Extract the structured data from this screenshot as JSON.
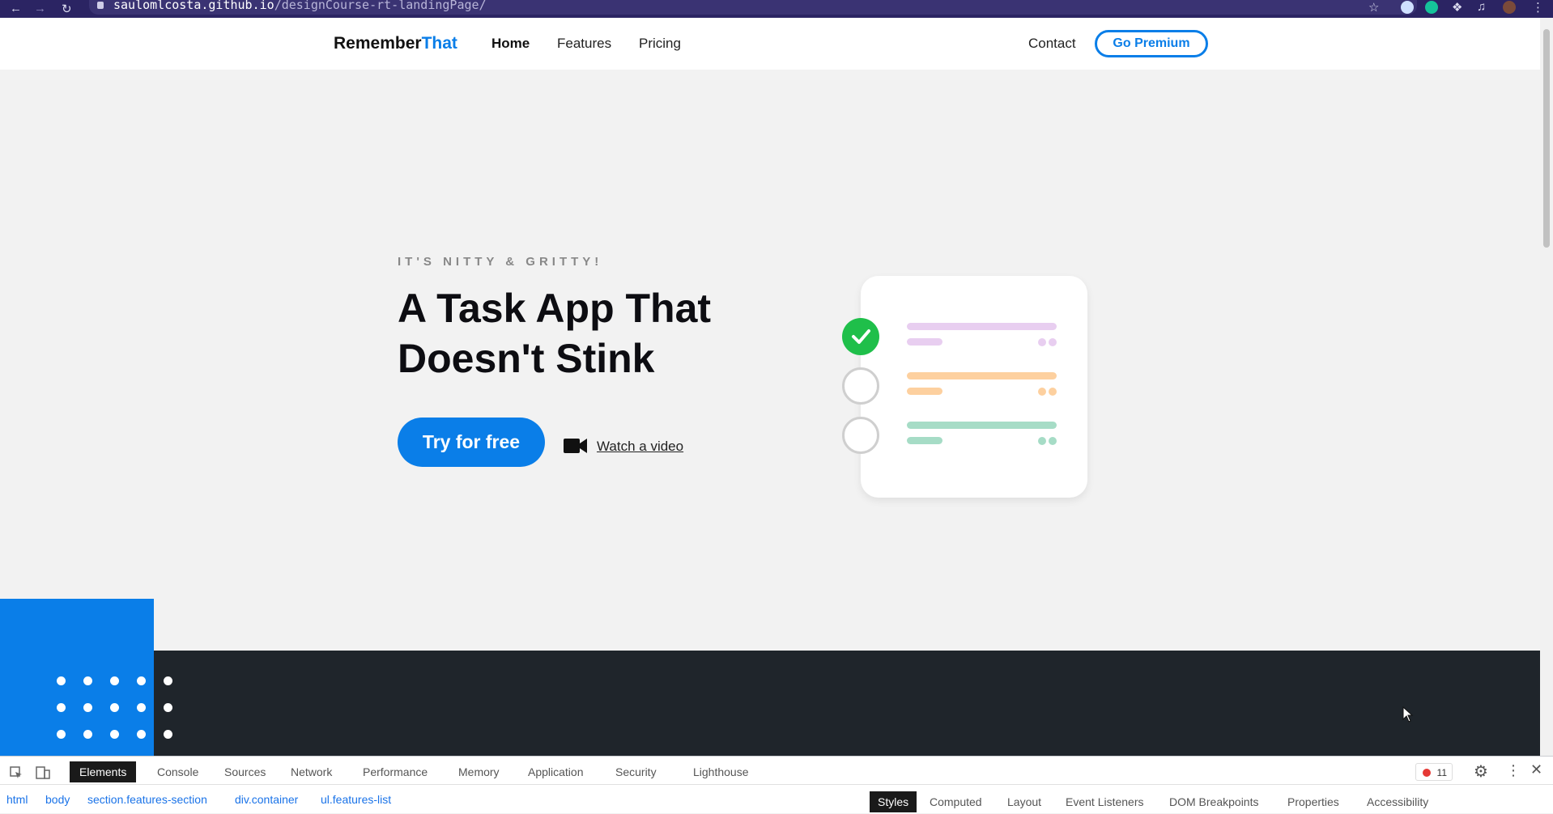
{
  "browser": {
    "url_host": "saulomlcosta.github.io",
    "url_path": "/designCourse-rt-landingPage/"
  },
  "header": {
    "logo_main": "Remember",
    "logo_accent": "That",
    "nav": [
      "Home",
      "Features",
      "Pricing"
    ],
    "contact": "Contact",
    "premium": "Go Premium"
  },
  "hero": {
    "eyebrow": "IT'S NITTY & GRITTY!",
    "title_line1": "A Task App That",
    "title_line2": "Doesn't Stink",
    "cta": "Try for free",
    "video_link": "Watch a video"
  },
  "illustration": {
    "rows": [
      {
        "checked": true,
        "color": "#e8cef0"
      },
      {
        "checked": false,
        "color": "#fdd09f"
      },
      {
        "checked": false,
        "color": "#a6dcc6"
      }
    ],
    "check_color": "#1fbf4a"
  },
  "colors": {
    "accent": "#0a7ee8",
    "dark_section": "#1f252b",
    "chrome": "#2b2463"
  },
  "devtools": {
    "tabs": [
      "Elements",
      "Console",
      "Sources",
      "Network",
      "Performance",
      "Memory",
      "Application",
      "Security",
      "Lighthouse"
    ],
    "error_count": "11",
    "breadcrumbs": [
      "html",
      "body",
      "section.features-section",
      "div.container",
      "ul.features-list"
    ],
    "side_tabs": [
      "Styles",
      "Computed",
      "Layout",
      "Event Listeners",
      "DOM Breakpoints",
      "Properties",
      "Accessibility"
    ]
  }
}
